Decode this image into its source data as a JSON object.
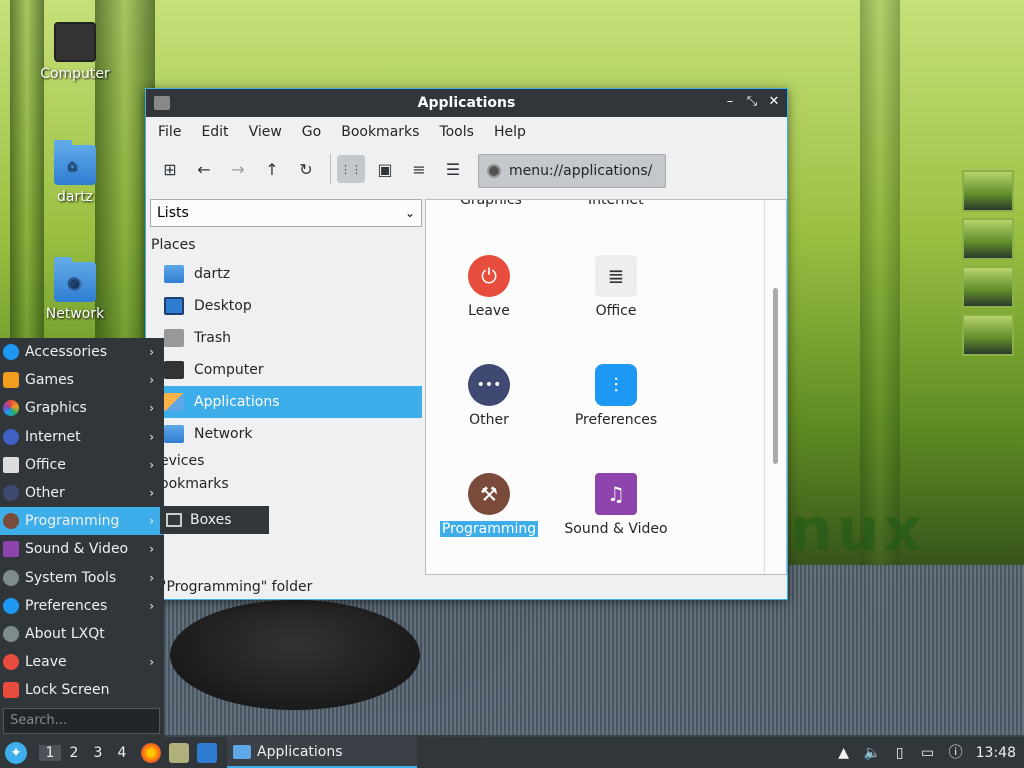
{
  "desktop": {
    "icons": [
      {
        "label": "Computer",
        "glyph": "monitor-icon"
      },
      {
        "label": "dartz",
        "glyph": "home-folder-icon"
      },
      {
        "label": "Network",
        "glyph": "network-folder-icon"
      }
    ]
  },
  "window": {
    "title": "Applications",
    "controls": {
      "minimize": "–",
      "restore": "⤡",
      "close": "✕"
    },
    "menubar": [
      "File",
      "Edit",
      "View",
      "Go",
      "Bookmarks",
      "Tools",
      "Help"
    ],
    "toolbar": {
      "new_tab": "⊞",
      "back": "←",
      "forward": "→",
      "up": "↑",
      "reload": "↻",
      "icon_view": "⋮⋮",
      "thumbnail_view": "▣",
      "compact_view": "≡",
      "detail_view": "☰"
    },
    "location": "menu://applications/",
    "side_pane": {
      "mode": "Lists",
      "places_heading": "Places",
      "places": [
        "dartz",
        "Desktop",
        "Trash",
        "Computer",
        "Applications",
        "Network"
      ],
      "selected": "Applications",
      "devices_heading": "evices",
      "bookmarks_heading": "ookmarks"
    },
    "view": {
      "cut_off_labels": [
        "Graphics",
        "Internet"
      ],
      "items": [
        {
          "label": "Leave",
          "color": "#e74c3c",
          "symbol": "⏻"
        },
        {
          "label": "Office",
          "color": "#eeeeee",
          "symbol": "≣"
        },
        {
          "label": "Other",
          "color": "#3f4a73",
          "symbol": "•••"
        },
        {
          "label": "Preferences",
          "color": "#1d99f3",
          "symbol": "⫶"
        },
        {
          "label": "Programming",
          "color": "#7a4a3a",
          "symbol": "⚒"
        },
        {
          "label": "Sound & Video",
          "color": "#8e44ad",
          "symbol": "♫"
        }
      ],
      "selected": "Programming"
    },
    "status": "\"Programming\" folder"
  },
  "start_menu": {
    "items": [
      {
        "label": "Accessories",
        "has_sub": true,
        "color": "#1d99f3"
      },
      {
        "label": "Games",
        "has_sub": true,
        "color": "#f39c1f"
      },
      {
        "label": "Graphics",
        "has_sub": true,
        "color": "#e74c3c"
      },
      {
        "label": "Internet",
        "has_sub": true,
        "color": "#3f61c4"
      },
      {
        "label": "Office",
        "has_sub": true,
        "color": "#dddddd"
      },
      {
        "label": "Other",
        "has_sub": true,
        "color": "#3f4a73"
      },
      {
        "label": "Programming",
        "has_sub": true,
        "color": "#7a4a3a"
      },
      {
        "label": "Sound & Video",
        "has_sub": true,
        "color": "#8e44ad"
      },
      {
        "label": "System Tools",
        "has_sub": true,
        "color": "#7f8c8d"
      },
      {
        "label": "Preferences",
        "has_sub": true,
        "color": "#1d99f3"
      },
      {
        "label": "About LXQt",
        "has_sub": false,
        "color": "#7f8c8d"
      },
      {
        "label": "Leave",
        "has_sub": true,
        "color": "#e74c3c"
      },
      {
        "label": "Lock Screen",
        "has_sub": false,
        "color": "#e74c3c"
      }
    ],
    "highlighted": "Programming",
    "search_placeholder": "Search...",
    "submenu_item": "Boxes"
  },
  "taskbar": {
    "desktops": [
      "1",
      "2",
      "3",
      "4"
    ],
    "current_desktop": "1",
    "task_label": "Applications",
    "clock": "13:48"
  },
  "wallpaper_text": "nux"
}
